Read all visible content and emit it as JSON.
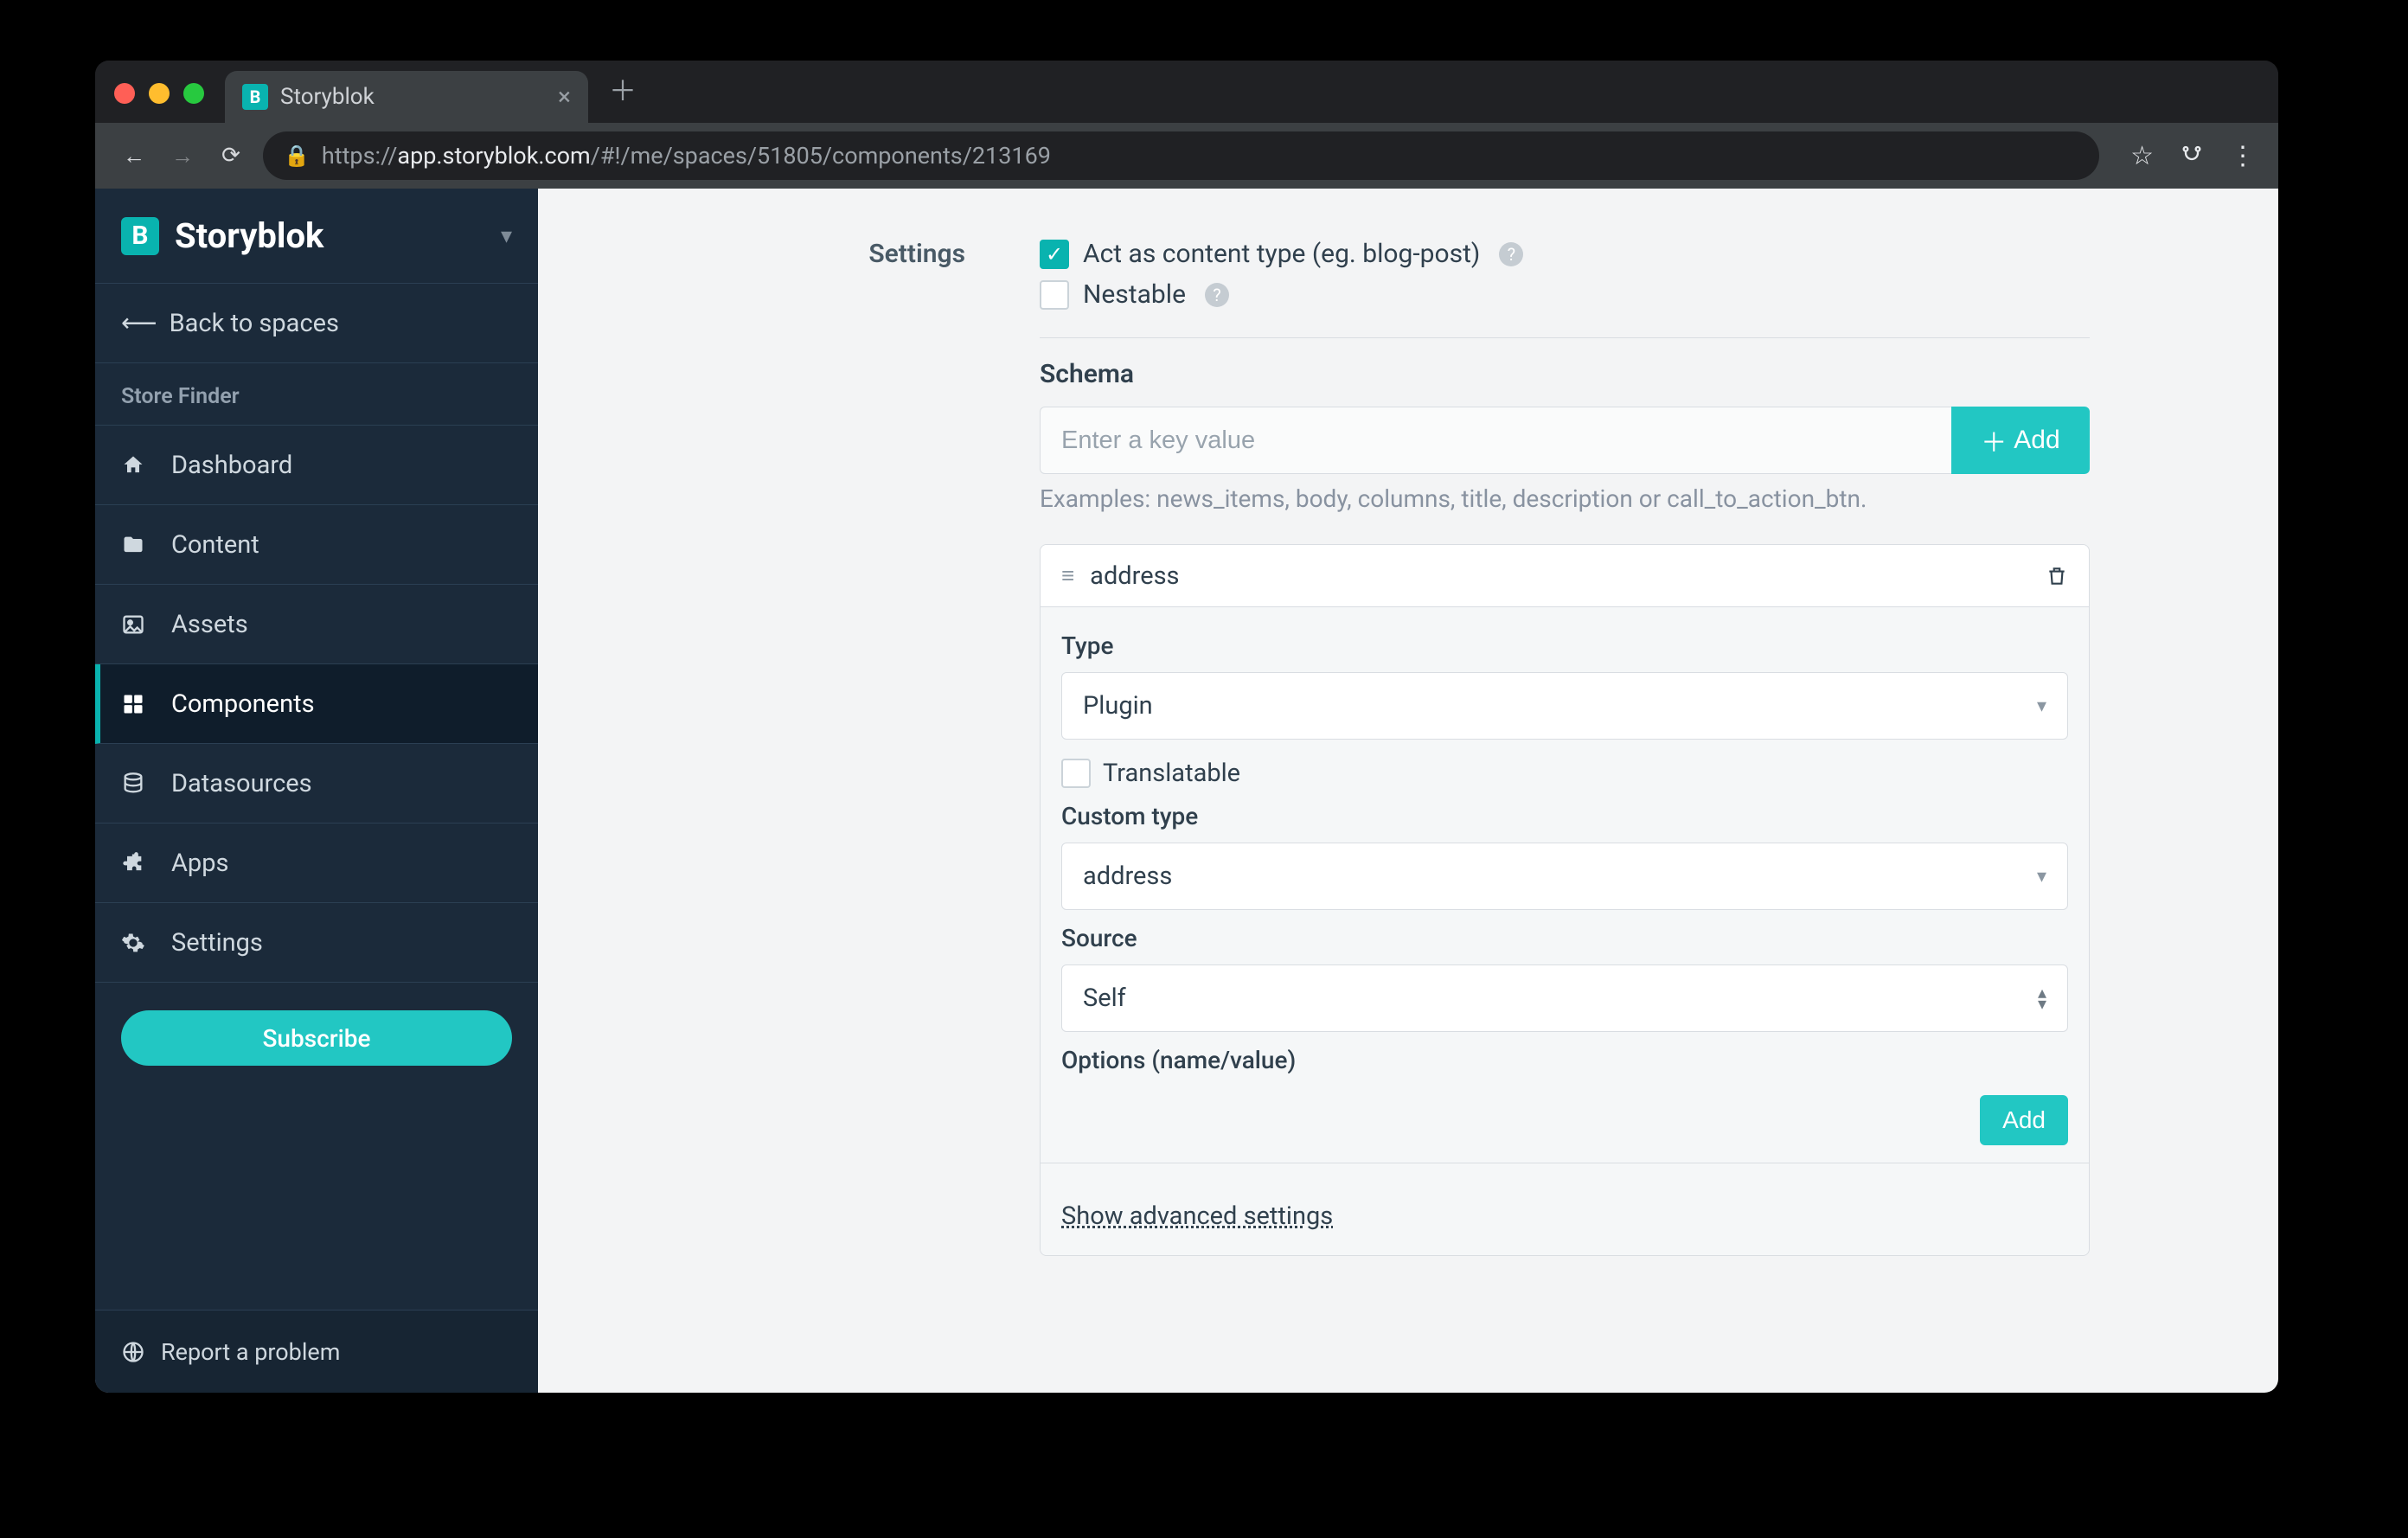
{
  "browser": {
    "tab_title": "Storyblok",
    "url_scheme": "https://",
    "url_host": "app.storyblok.com",
    "url_path": "/#!/me/spaces/51805/components/213169"
  },
  "sidebar": {
    "brand": "Storyblok",
    "back": "Back to spaces",
    "space_name": "Store Finder",
    "items": [
      {
        "icon": "home",
        "label": "Dashboard"
      },
      {
        "icon": "folder",
        "label": "Content"
      },
      {
        "icon": "image",
        "label": "Assets"
      },
      {
        "icon": "blocks",
        "label": "Components"
      },
      {
        "icon": "db",
        "label": "Datasources"
      },
      {
        "icon": "puzzle",
        "label": "Apps"
      },
      {
        "icon": "gear",
        "label": "Settings"
      }
    ],
    "subscribe": "Subscribe",
    "report": "Report a problem"
  },
  "content": {
    "left_label": "Settings",
    "cb_content_type": "Act as content type (eg. blog-post)",
    "cb_nestable": "Nestable",
    "schema_heading": "Schema",
    "key_placeholder": "Enter a key value",
    "add_btn": "Add",
    "hint": "Examples: news_items, body, columns, title, description or call_to_action_btn.",
    "field_name": "address",
    "type_label": "Type",
    "type_value": "Plugin",
    "translatable": "Translatable",
    "custom_type_label": "Custom type",
    "custom_type_value": "address",
    "source_label": "Source",
    "source_value": "Self",
    "options_label": "Options (name/value)",
    "add_small": "Add",
    "advanced": "Show advanced settings"
  }
}
